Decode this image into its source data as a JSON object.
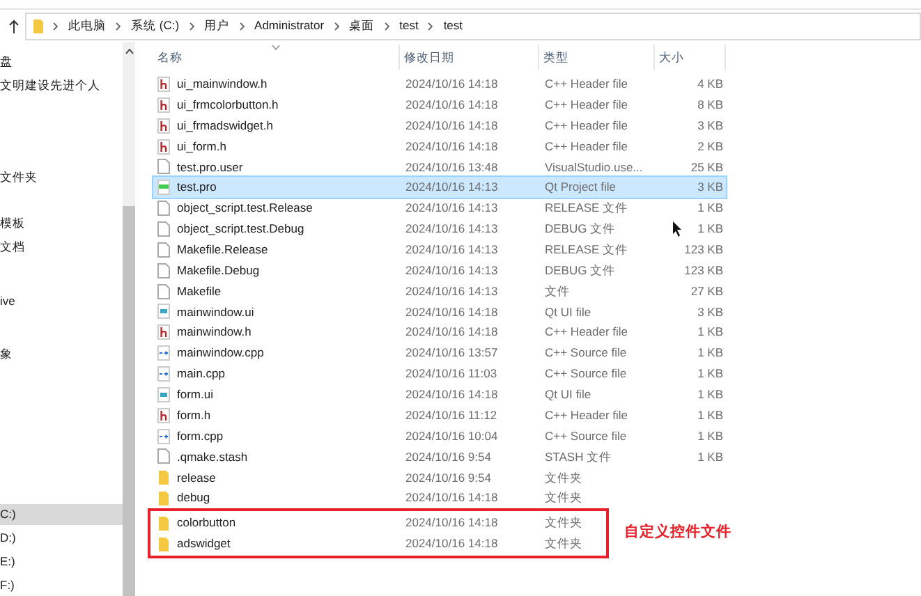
{
  "breadcrumb": [
    "此电脑",
    "系统 (C:)",
    "用户",
    "Administrator",
    "桌面",
    "test",
    "test"
  ],
  "sidebar": {
    "items": [
      {
        "label": "盘",
        "selected": false
      },
      {
        "label": "文明建设先进个人",
        "selected": false
      },
      {
        "label": "文件夹",
        "selected": false
      },
      {
        "label": "模板",
        "selected": false
      },
      {
        "label": "文档",
        "selected": false
      },
      {
        "label": "ive",
        "selected": false
      },
      {
        "label": "象",
        "selected": false
      },
      {
        "label": "C:)",
        "selected": true
      },
      {
        "label": "D:)",
        "selected": false
      },
      {
        "label": "E:)",
        "selected": false
      },
      {
        "label": "F:)",
        "selected": false
      }
    ]
  },
  "columns": [
    "名称",
    "修改日期",
    "类型",
    "大小"
  ],
  "rows": [
    {
      "kind": "header",
      "name": "ui_mainwindow.h",
      "date": "2024/10/16 14:18",
      "type": "C++ Header file",
      "size": "4 KB",
      "selected": false,
      "highlighted": false
    },
    {
      "kind": "header",
      "name": "ui_frmcolorbutton.h",
      "date": "2024/10/16 14:18",
      "type": "C++ Header file",
      "size": "8 KB",
      "selected": false,
      "highlighted": false
    },
    {
      "kind": "header",
      "name": "ui_frmadswidget.h",
      "date": "2024/10/16 14:18",
      "type": "C++ Header file",
      "size": "3 KB",
      "selected": false,
      "highlighted": false
    },
    {
      "kind": "header",
      "name": "ui_form.h",
      "date": "2024/10/16 14:18",
      "type": "C++ Header file",
      "size": "2 KB",
      "selected": false,
      "highlighted": false
    },
    {
      "kind": "file",
      "name": "test.pro.user",
      "date": "2024/10/16 13:48",
      "type": "VisualStudio.use...",
      "size": "25 KB",
      "selected": false,
      "highlighted": false
    },
    {
      "kind": "pro",
      "name": "test.pro",
      "date": "2024/10/16 14:13",
      "type": "Qt Project file",
      "size": "3 KB",
      "selected": true,
      "highlighted": false
    },
    {
      "kind": "file",
      "name": "object_script.test.Release",
      "date": "2024/10/16 14:13",
      "type": "RELEASE 文件",
      "size": "1 KB",
      "selected": false,
      "highlighted": false
    },
    {
      "kind": "file",
      "name": "object_script.test.Debug",
      "date": "2024/10/16 14:13",
      "type": "DEBUG 文件",
      "size": "1 KB",
      "selected": false,
      "highlighted": false
    },
    {
      "kind": "file",
      "name": "Makefile.Release",
      "date": "2024/10/16 14:13",
      "type": "RELEASE 文件",
      "size": "123 KB",
      "selected": false,
      "highlighted": false
    },
    {
      "kind": "file",
      "name": "Makefile.Debug",
      "date": "2024/10/16 14:13",
      "type": "DEBUG 文件",
      "size": "123 KB",
      "selected": false,
      "highlighted": false
    },
    {
      "kind": "file",
      "name": "Makefile",
      "date": "2024/10/16 14:13",
      "type": "文件",
      "size": "27 KB",
      "selected": false,
      "highlighted": false
    },
    {
      "kind": "ui",
      "name": "mainwindow.ui",
      "date": "2024/10/16 14:18",
      "type": "Qt UI file",
      "size": "3 KB",
      "selected": false,
      "highlighted": false
    },
    {
      "kind": "header",
      "name": "mainwindow.h",
      "date": "2024/10/16 14:18",
      "type": "C++ Header file",
      "size": "1 KB",
      "selected": false,
      "highlighted": false
    },
    {
      "kind": "cpp",
      "name": "mainwindow.cpp",
      "date": "2024/10/16 13:57",
      "type": "C++ Source file",
      "size": "1 KB",
      "selected": false,
      "highlighted": false
    },
    {
      "kind": "cpp",
      "name": "main.cpp",
      "date": "2024/10/16 11:03",
      "type": "C++ Source file",
      "size": "1 KB",
      "selected": false,
      "highlighted": false
    },
    {
      "kind": "ui",
      "name": "form.ui",
      "date": "2024/10/16 14:18",
      "type": "Qt UI file",
      "size": "1 KB",
      "selected": false,
      "highlighted": false
    },
    {
      "kind": "header",
      "name": "form.h",
      "date": "2024/10/16 11:12",
      "type": "C++ Header file",
      "size": "1 KB",
      "selected": false,
      "highlighted": false
    },
    {
      "kind": "cpp",
      "name": "form.cpp",
      "date": "2024/10/16 10:04",
      "type": "C++ Source file",
      "size": "1 KB",
      "selected": false,
      "highlighted": false
    },
    {
      "kind": "file",
      "name": ".qmake.stash",
      "date": "2024/10/16 9:54",
      "type": "STASH 文件",
      "size": "1 KB",
      "selected": false,
      "highlighted": false
    },
    {
      "kind": "folder",
      "name": "release",
      "date": "2024/10/16 9:54",
      "type": "文件夹",
      "selected": false,
      "highlighted": false
    },
    {
      "kind": "folder",
      "name": "debug",
      "date": "2024/10/16 14:18",
      "type": "文件夹",
      "selected": false,
      "highlighted": false
    },
    {
      "kind": "folder",
      "name": "colorbutton",
      "date": "2024/10/16 14:18",
      "type": "文件夹",
      "selected": false,
      "highlighted": true
    },
    {
      "kind": "folder",
      "name": "adswidget",
      "date": "2024/10/16 14:18",
      "type": "文件夹",
      "selected": false,
      "highlighted": true
    }
  ],
  "annotation": "自定义控件文件"
}
